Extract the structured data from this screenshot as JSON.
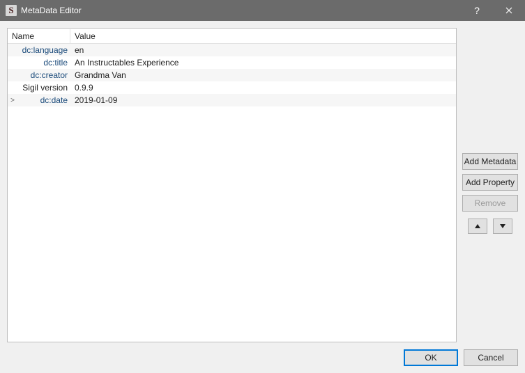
{
  "window": {
    "app_icon_letter": "S",
    "title": "MetaData Editor"
  },
  "columns": {
    "name": "Name",
    "value": "Value"
  },
  "rows": [
    {
      "expander": "",
      "name": "dc:language",
      "plain": false,
      "value": "en"
    },
    {
      "expander": "",
      "name": "dc:title",
      "plain": false,
      "value": "An Instructables Experience"
    },
    {
      "expander": "",
      "name": "dc:creator",
      "plain": false,
      "value": "Grandma Van"
    },
    {
      "expander": "",
      "name": "Sigil version",
      "plain": true,
      "value": "0.9.9"
    },
    {
      "expander": ">",
      "name": "dc:date",
      "plain": false,
      "value": "2019-01-09"
    }
  ],
  "buttons": {
    "add_metadata": "Add Metadata",
    "add_property": "Add Property",
    "remove": "Remove",
    "ok": "OK",
    "cancel": "Cancel"
  }
}
